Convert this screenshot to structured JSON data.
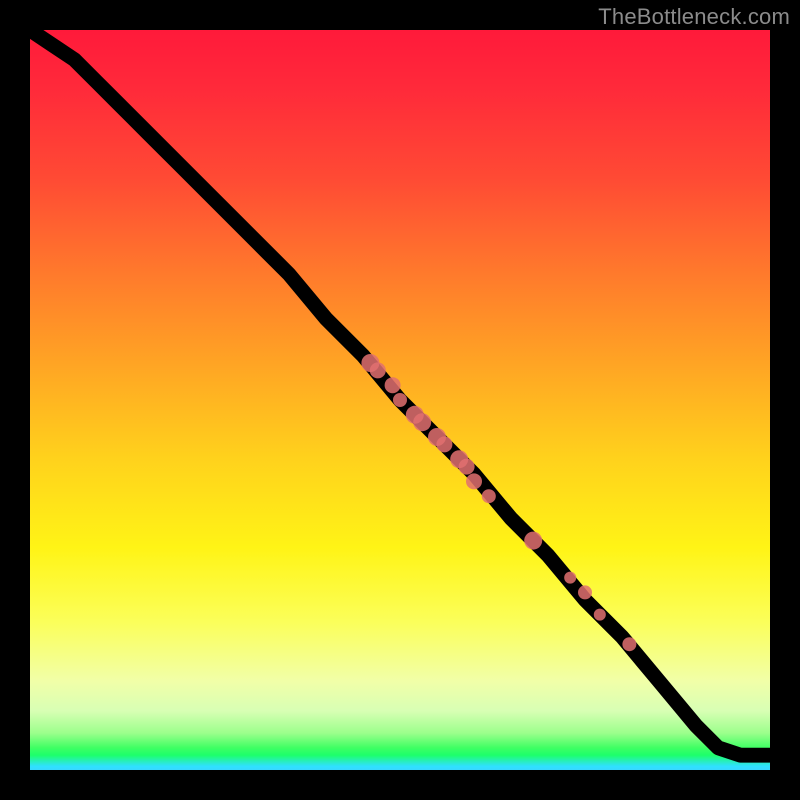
{
  "watermark": "TheBottleneck.com",
  "chart_data": {
    "type": "line",
    "title": "",
    "xlabel": "",
    "ylabel": "",
    "xlim": [
      0,
      100
    ],
    "ylim": [
      0,
      100
    ],
    "grid": false,
    "legend": false,
    "background_gradient_stops": [
      {
        "pos": 0,
        "color": "#ff1a3a"
      },
      {
        "pos": 8,
        "color": "#ff2a3a"
      },
      {
        "pos": 20,
        "color": "#ff4a34"
      },
      {
        "pos": 33,
        "color": "#ff7a2c"
      },
      {
        "pos": 45,
        "color": "#ffa424"
      },
      {
        "pos": 58,
        "color": "#ffd21c"
      },
      {
        "pos": 70,
        "color": "#fff416"
      },
      {
        "pos": 80,
        "color": "#fbff5a"
      },
      {
        "pos": 88,
        "color": "#f1ffa8"
      },
      {
        "pos": 92,
        "color": "#d8ffb4"
      },
      {
        "pos": 95,
        "color": "#9cff8c"
      },
      {
        "pos": 97,
        "color": "#3fff63"
      },
      {
        "pos": 98,
        "color": "#1dff6b"
      },
      {
        "pos": 99.5,
        "color": "#30e0ff"
      },
      {
        "pos": 100,
        "color": "#38d8ff"
      }
    ],
    "series": [
      {
        "name": "curve",
        "x": [
          0,
          3,
          6,
          9,
          12,
          16,
          20,
          25,
          30,
          35,
          40,
          45,
          50,
          55,
          60,
          65,
          70,
          75,
          80,
          85,
          90,
          93,
          96,
          100
        ],
        "y": [
          100,
          98,
          96,
          93,
          90,
          86,
          82,
          77,
          72,
          67,
          61,
          56,
          50,
          45,
          40,
          34,
          29,
          23,
          18,
          12,
          6,
          3,
          2,
          2
        ]
      }
    ],
    "markers": {
      "name": "highlighted-points",
      "color": "#e07070",
      "points": [
        {
          "x": 46,
          "y": 55,
          "r": 9
        },
        {
          "x": 47,
          "y": 54,
          "r": 8
        },
        {
          "x": 49,
          "y": 52,
          "r": 8
        },
        {
          "x": 50,
          "y": 50,
          "r": 7
        },
        {
          "x": 52,
          "y": 48,
          "r": 9
        },
        {
          "x": 53,
          "y": 47,
          "r": 9
        },
        {
          "x": 55,
          "y": 45,
          "r": 9
        },
        {
          "x": 56,
          "y": 44,
          "r": 8
        },
        {
          "x": 58,
          "y": 42,
          "r": 9
        },
        {
          "x": 59,
          "y": 41,
          "r": 8
        },
        {
          "x": 60,
          "y": 39,
          "r": 8
        },
        {
          "x": 62,
          "y": 37,
          "r": 7
        },
        {
          "x": 68,
          "y": 31,
          "r": 9
        },
        {
          "x": 73,
          "y": 26,
          "r": 6
        },
        {
          "x": 75,
          "y": 24,
          "r": 7
        },
        {
          "x": 77,
          "y": 21,
          "r": 6
        },
        {
          "x": 81,
          "y": 17,
          "r": 7
        }
      ]
    }
  }
}
